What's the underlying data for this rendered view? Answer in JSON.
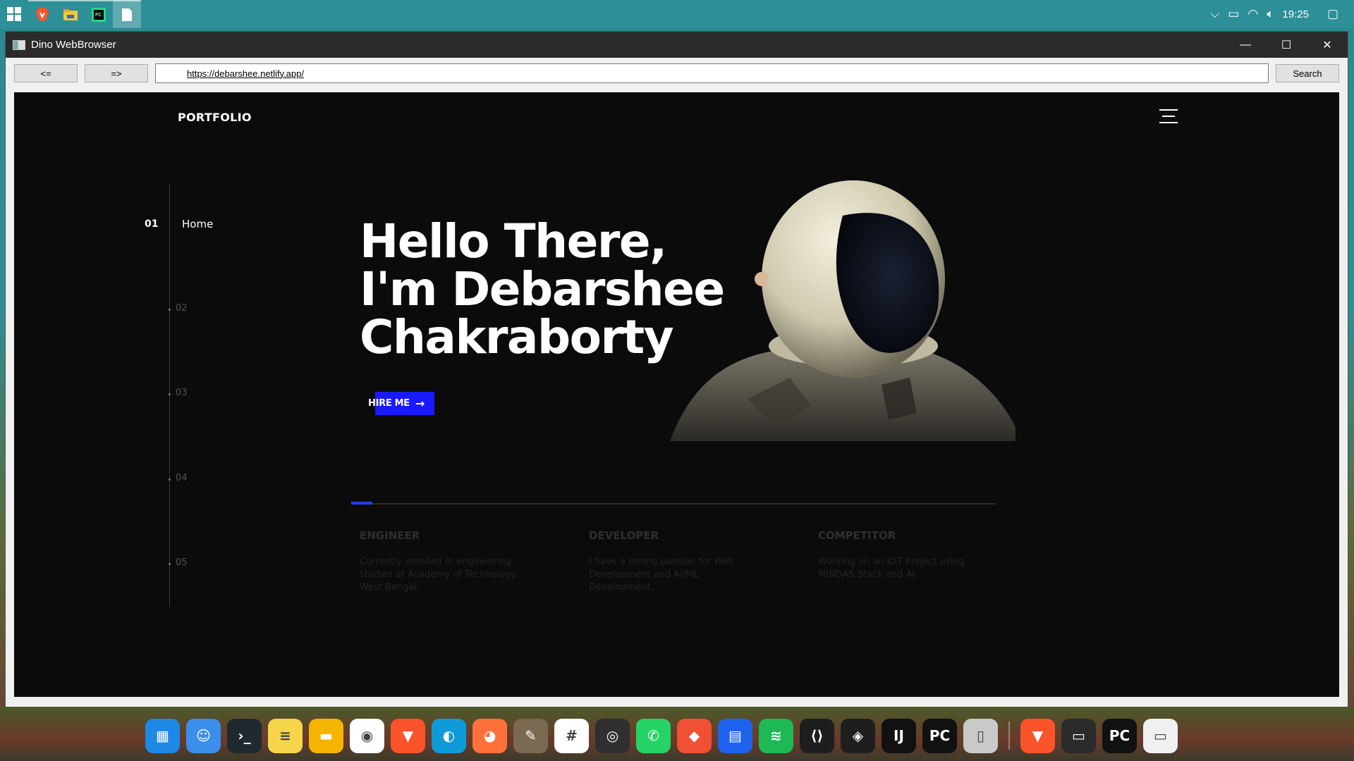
{
  "taskbar": {
    "apps": [
      {
        "name": "start-icon"
      },
      {
        "name": "brave-icon",
        "color": "#fb542b"
      },
      {
        "name": "file-explorer-icon",
        "color": "#f4c542"
      },
      {
        "name": "pycharm-icon",
        "color": "#21d789"
      },
      {
        "name": "document-icon",
        "color": "#ffffff"
      }
    ],
    "clock": "19:25"
  },
  "window": {
    "title": "Dino WebBrowser",
    "minimize": "—",
    "maximize": "☐",
    "close": "✕"
  },
  "toolbar": {
    "back_label": "<=",
    "forward_label": "=>",
    "url": "https://debarshee.netlify.app/",
    "search_label": "Search"
  },
  "page": {
    "brand": "PORTFOLIO",
    "sections": [
      "01",
      "02",
      "03",
      "04",
      "05"
    ],
    "active_section_label": "Home",
    "hero_lines": [
      "Hello There,",
      "I'm Debarshee",
      "Chakraborty"
    ],
    "hire_button": "HIRE ME",
    "hire_arrow": "→",
    "accent_color": "#1a1aff",
    "features": [
      {
        "title": "ENGINEER",
        "text": "Currently enrolled in engineering studies at Academy of Technology, West Bengal."
      },
      {
        "title": "DEVELOPER",
        "text": "I have a strong passion for Web Development and AI/ML Development."
      },
      {
        "title": "COMPETITOR",
        "text": "Working on an IOT Project using MINDAS Stack and AI."
      }
    ]
  },
  "dock": {
    "icons": [
      {
        "name": "launchpad-icon",
        "glyph": "▦",
        "bg": "#1e88e5"
      },
      {
        "name": "finder-icon",
        "glyph": "☺",
        "bg": "#3b8eea"
      },
      {
        "name": "terminal-icon",
        "glyph": "›_",
        "bg": "#1f2a2e"
      },
      {
        "name": "notes-icon",
        "glyph": "≡",
        "bg": "#f6d54a"
      },
      {
        "name": "files-icon",
        "glyph": "▬",
        "bg": "#f5b400"
      },
      {
        "name": "chrome-icon",
        "glyph": "◉",
        "bg": "#ffffff"
      },
      {
        "name": "brave-icon",
        "glyph": "▼",
        "bg": "#fb542b"
      },
      {
        "name": "edge-icon",
        "glyph": "◐",
        "bg": "#0f9bd7"
      },
      {
        "name": "firefox-icon",
        "glyph": "◕",
        "bg": "#ff7139"
      },
      {
        "name": "gimp-icon",
        "glyph": "✎",
        "bg": "#7a6a52"
      },
      {
        "name": "slack-icon",
        "glyph": "#",
        "bg": "#ffffff"
      },
      {
        "name": "obs-icon",
        "glyph": "◎",
        "bg": "#302e31"
      },
      {
        "name": "whatsapp-icon",
        "glyph": "✆",
        "bg": "#25d366"
      },
      {
        "name": "git-icon",
        "glyph": "◆",
        "bg": "#f05033"
      },
      {
        "name": "docker-icon",
        "glyph": "▤",
        "bg": "#1d63ed"
      },
      {
        "name": "spotify-icon",
        "glyph": "≋",
        "bg": "#1db954"
      },
      {
        "name": "vscode-icon",
        "glyph": "⟨⟩",
        "bg": "#1e1e1e"
      },
      {
        "name": "figma-icon",
        "glyph": "◈",
        "bg": "#1e1e1e"
      },
      {
        "name": "intellij-icon",
        "glyph": "IJ",
        "bg": "#111111"
      },
      {
        "name": "pycharm-icon",
        "glyph": "PC",
        "bg": "#111111"
      },
      {
        "name": "trash-icon",
        "glyph": "▯",
        "bg": "#c9c9c9"
      }
    ],
    "recent": [
      {
        "name": "brave-recent-icon",
        "glyph": "▼",
        "bg": "#fb542b"
      },
      {
        "name": "window-preview-icon",
        "glyph": "▭",
        "bg": "#2b2b2b"
      },
      {
        "name": "pycharm-recent-icon",
        "glyph": "PC",
        "bg": "#111111"
      },
      {
        "name": "browser-preview-icon",
        "glyph": "▭",
        "bg": "#f0f0f0"
      }
    ]
  }
}
